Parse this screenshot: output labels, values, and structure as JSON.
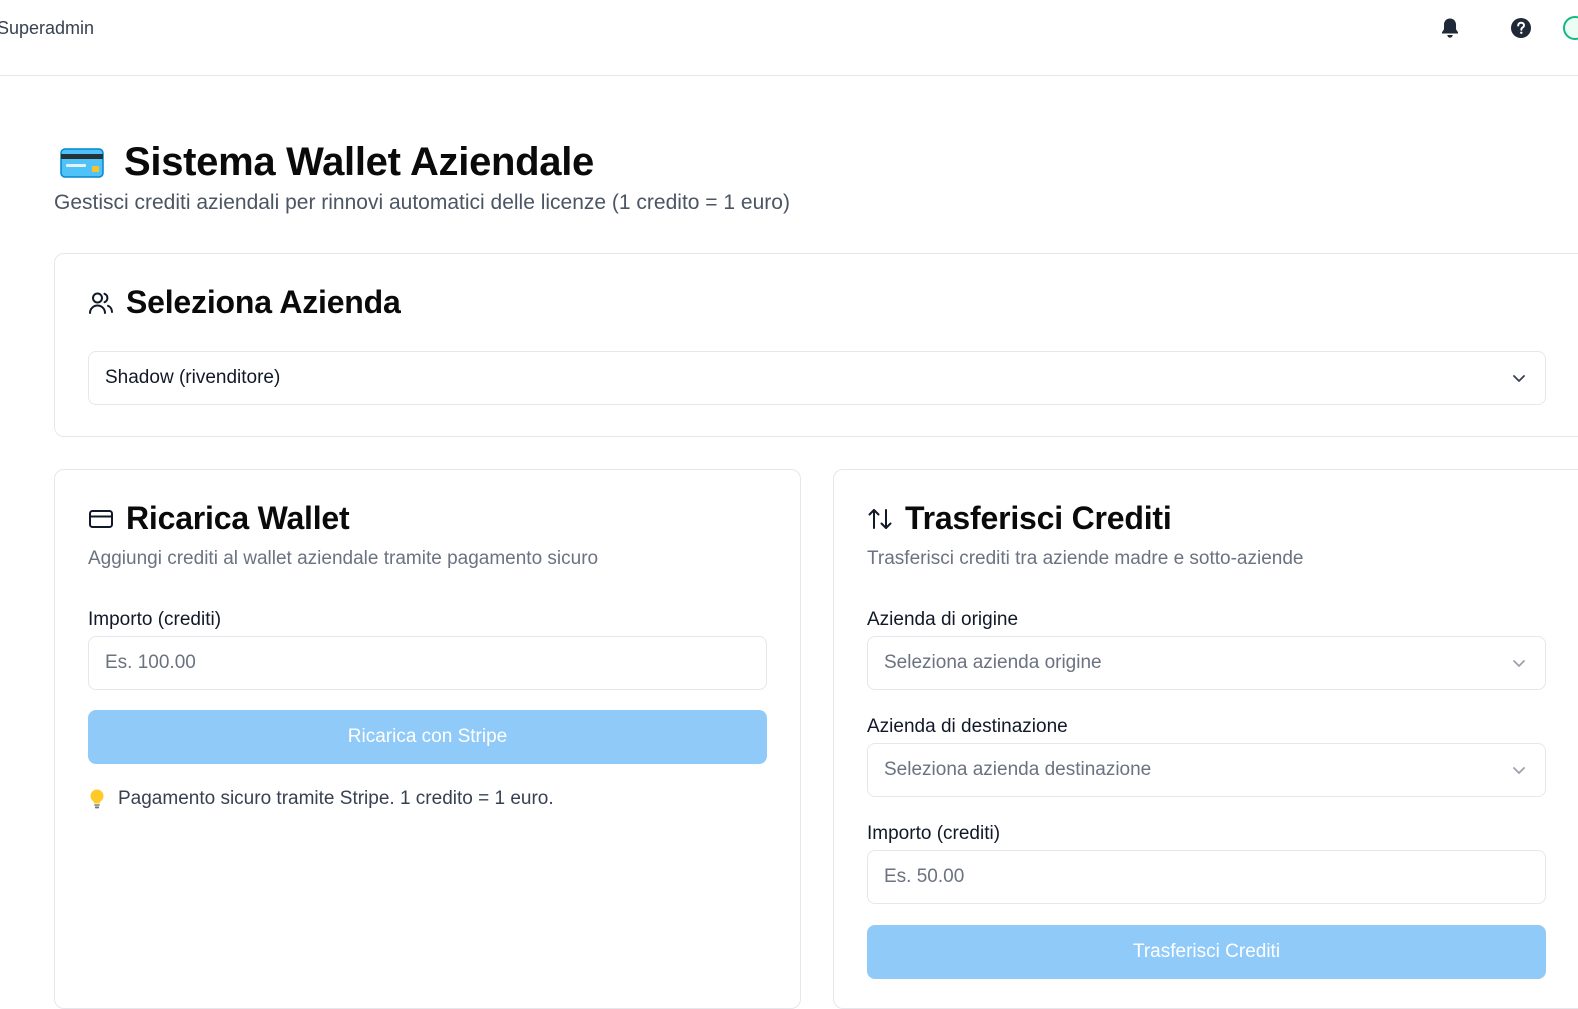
{
  "topbar": {
    "user_label": "Superadmin",
    "icons": [
      "bell-icon",
      "help-icon"
    ]
  },
  "header": {
    "title": "Sistema Wallet Aziendale",
    "subtitle": "Gestisci crediti aziendali per rinnovi automatici delle licenze (1 credito = 1 euro)",
    "icon": "credit-card-emoji"
  },
  "company_card": {
    "title": "Seleziona Azienda",
    "icon": "users-icon",
    "selected": "Shadow (rivenditore)"
  },
  "recharge_card": {
    "title": "Ricarica Wallet",
    "icon": "credit-card-icon",
    "description": "Aggiungi crediti al wallet aziendale tramite pagamento sicuro",
    "amount_label": "Importo (crediti)",
    "amount_placeholder": "Es. 100.00",
    "button_label": "Ricarica con Stripe",
    "hint": "Pagamento sicuro tramite Stripe. 1 credito = 1 euro.",
    "hint_icon": "lightbulb-icon"
  },
  "transfer_card": {
    "title": "Trasferisci Crediti",
    "icon": "arrows-up-down-icon",
    "description": "Trasferisci crediti tra aziende madre e sotto-aziende",
    "origin_label": "Azienda di origine",
    "origin_placeholder": "Seleziona azienda origine",
    "destination_label": "Azienda di destinazione",
    "destination_placeholder": "Seleziona azienda destinazione",
    "amount_label": "Importo (crediti)",
    "amount_placeholder": "Es. 50.00",
    "button_label": "Trasferisci Crediti"
  },
  "colors": {
    "button_disabled": "#90caf9",
    "border": "#e5e7eb",
    "muted_text": "#6b7280"
  }
}
